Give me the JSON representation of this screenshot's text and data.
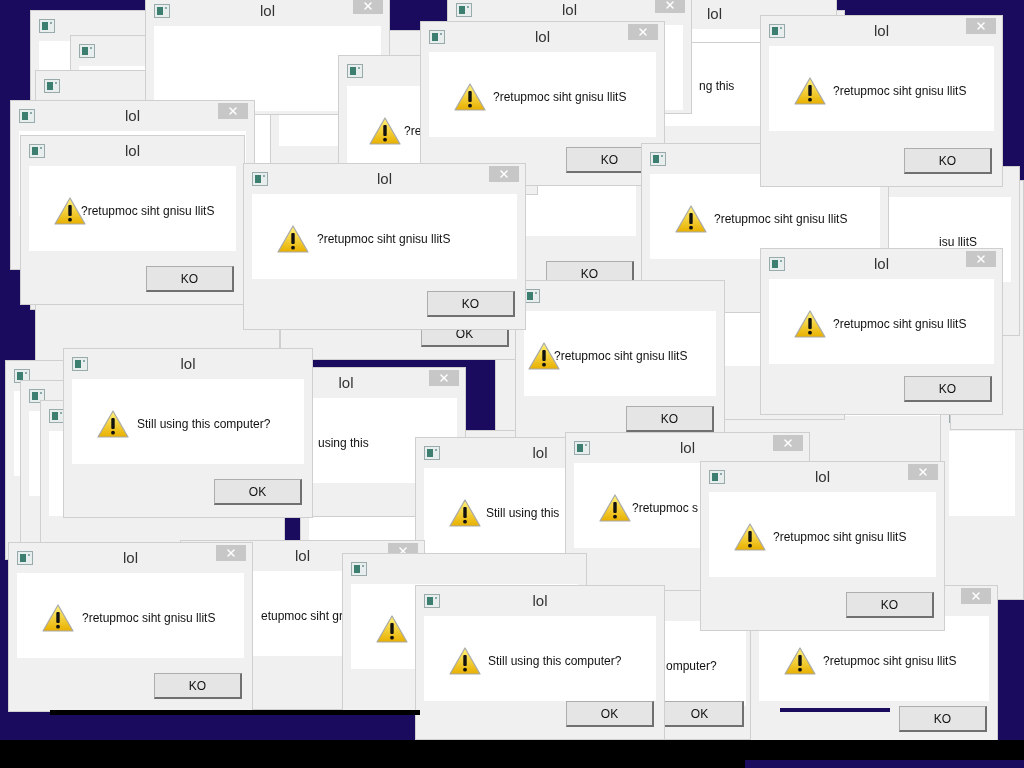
{
  "windows": [
    {
      "title": "lol",
      "close": true
    },
    {
      "title": "lol",
      "close": true
    },
    {
      "title": "lol",
      "close": false
    },
    {
      "message": "ng this",
      "close": false
    },
    {
      "button": "KO",
      "close": false
    },
    {
      "message": "?re",
      "close": false
    },
    {
      "button": "OK",
      "close": false
    },
    {
      "title": "lol",
      "close": true
    },
    {
      "title": "lol",
      "message": "?retupmoc siht gnisu llitS",
      "button": "KO",
      "close": false
    },
    {
      "title": "lol",
      "message": "?retupmoc siht gnisu llitS",
      "button": "KO",
      "close": true
    },
    {
      "message": "isu llitS",
      "close": false
    },
    {
      "message": "?retupmoc siht gnisu llitS",
      "close": false
    },
    {
      "title": "lol",
      "message": "?retupmoc siht gnisu llitS",
      "button": "KO",
      "close": true
    },
    {
      "message": "?retupmoc siht gnisu llitS",
      "button": "KO",
      "close": false
    },
    {
      "title": "lol",
      "message": "?retupmoc siht gnisu llitS",
      "button": "KO",
      "close": true
    },
    {
      "title": "lol",
      "message": "?retupmoc siht gnisu llitS",
      "button": "KO",
      "close": true
    },
    {
      "title": "lol",
      "message": "using this",
      "close": true
    },
    {
      "title": "lol",
      "message": "Still using this computer?",
      "button": "OK",
      "close": false
    },
    {
      "title": "lol",
      "message": "Still using this",
      "close": false
    },
    {
      "title": "lol",
      "message": "?retupmoc s",
      "close": true
    },
    {
      "title": "lol",
      "message": "?retupmoc siht gnisu llitS",
      "button": "KO",
      "close": true
    },
    {
      "title": "lol",
      "message": "etupmoc siht gr",
      "close": true
    },
    {
      "close": false
    },
    {
      "title": "lol",
      "message": "Still using this computer?",
      "button": "OK",
      "close": false
    },
    {
      "message": "omputer?",
      "button": "OK",
      "close": false
    },
    {
      "message": "?retupmoc siht gnisu llitS",
      "button": "KO",
      "close": true
    },
    {
      "title": "lol",
      "message": "?retupmoc siht gnisu llitS",
      "button": "KO",
      "close": true
    }
  ]
}
